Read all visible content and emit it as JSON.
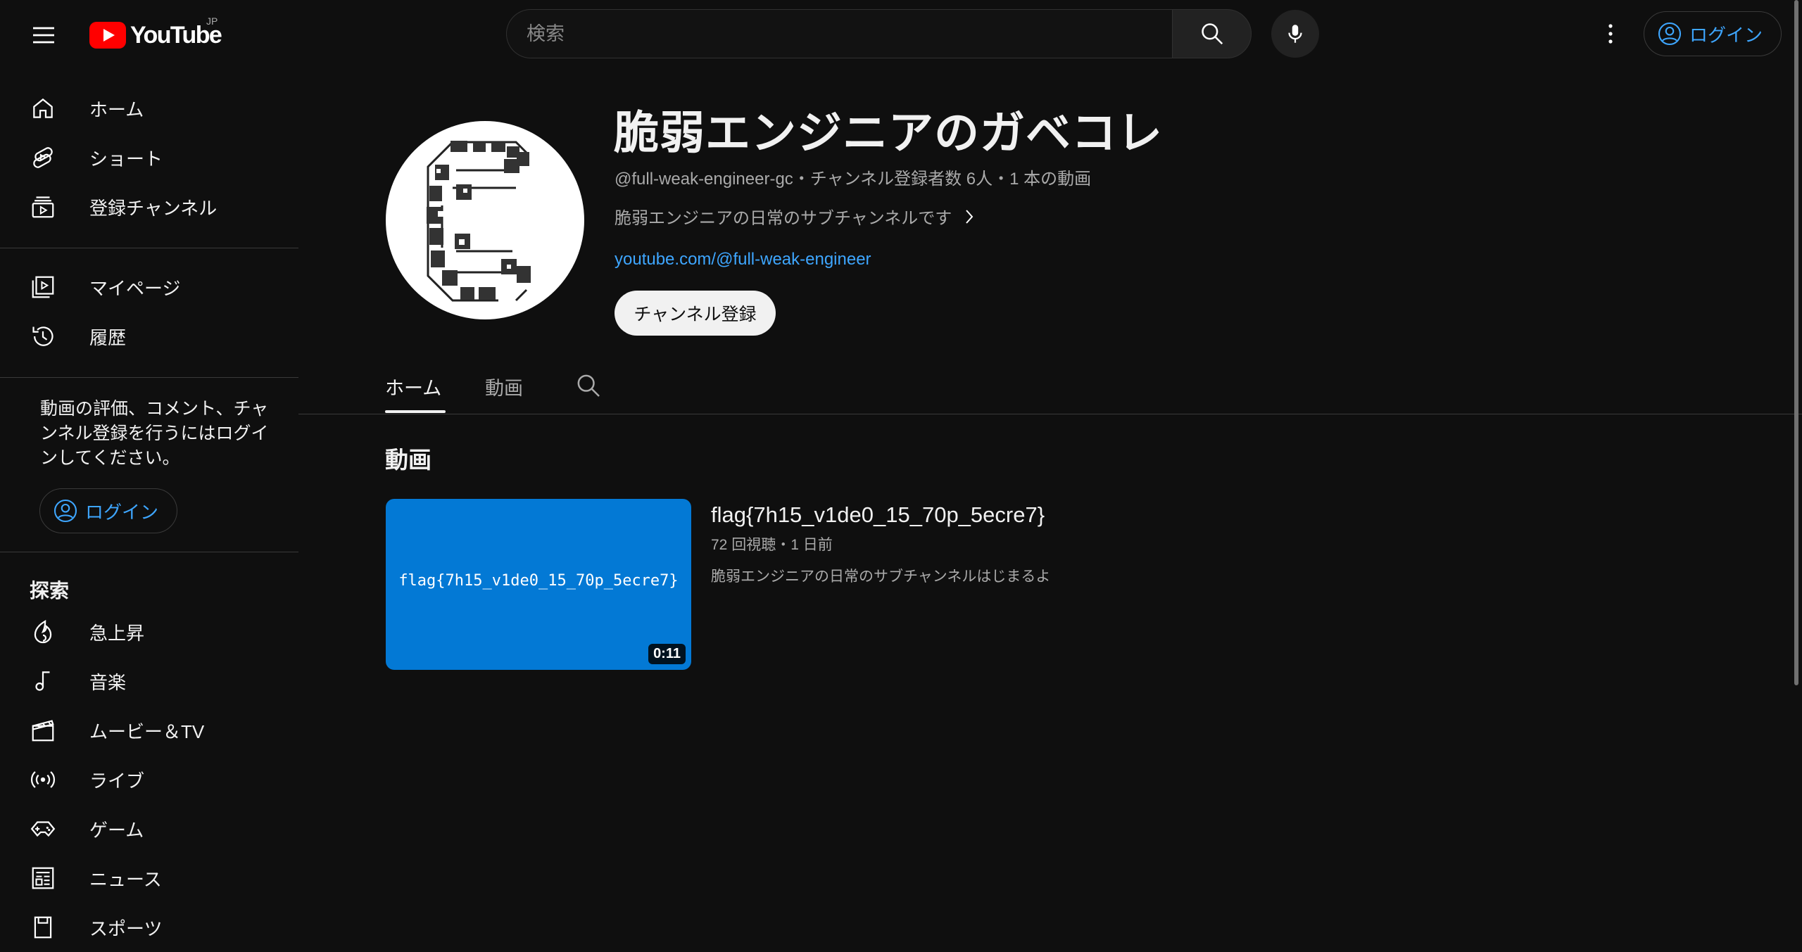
{
  "masthead": {
    "logo_text": "YouTube",
    "region": "JP",
    "search_placeholder": "検索",
    "login_label": "ログイン"
  },
  "sidebar": {
    "main_items": [
      {
        "label": "ホーム",
        "icon": "home-icon"
      },
      {
        "label": "ショート",
        "icon": "shorts-icon"
      },
      {
        "label": "登録チャンネル",
        "icon": "subscriptions-icon"
      }
    ],
    "you_items": [
      {
        "label": "マイページ",
        "icon": "library-icon"
      },
      {
        "label": "履歴",
        "icon": "history-icon"
      }
    ],
    "login_prompt": "動画の評価、コメント、チャンネル登録を行うにはログインしてください。",
    "login_label": "ログイン",
    "explore_heading": "探索",
    "explore_items": [
      {
        "label": "急上昇",
        "icon": "trending-icon"
      },
      {
        "label": "音楽",
        "icon": "music-icon"
      },
      {
        "label": "ムービー＆TV",
        "icon": "movies-icon"
      },
      {
        "label": "ライブ",
        "icon": "live-icon"
      },
      {
        "label": "ゲーム",
        "icon": "gaming-icon"
      },
      {
        "label": "ニュース",
        "icon": "news-icon"
      },
      {
        "label": "スポーツ",
        "icon": "sports-icon"
      }
    ]
  },
  "channel": {
    "title": "脆弱エンジニアのガベコレ",
    "meta": "@full-weak-engineer-gc・チャンネル登録者数 6人・1 本の動画",
    "description": "脆弱エンジニアの日常のサブチャンネルです",
    "link": "youtube.com/@full-weak-engineer",
    "subscribe_label": "チャンネル登録"
  },
  "tabs": [
    {
      "label": "ホーム",
      "selected": true
    },
    {
      "label": "動画",
      "selected": false
    }
  ],
  "section": {
    "title": "動画",
    "videos": [
      {
        "title": "flag{7h15_v1de0_15_70p_5ecre7}",
        "thumbnail_text": "flag{7h15_v1de0_15_70p_5ecre7}",
        "duration": "0:11",
        "meta": "72 回視聴・1 日前",
        "description": "脆弱エンジニアの日常のサブチャンネルはじまるよ"
      }
    ]
  },
  "colors": {
    "background": "#0f0f0f",
    "accent_link": "#3ea6ff",
    "brand_red": "#ff0000",
    "thumbnail_blue": "#0379d5"
  }
}
